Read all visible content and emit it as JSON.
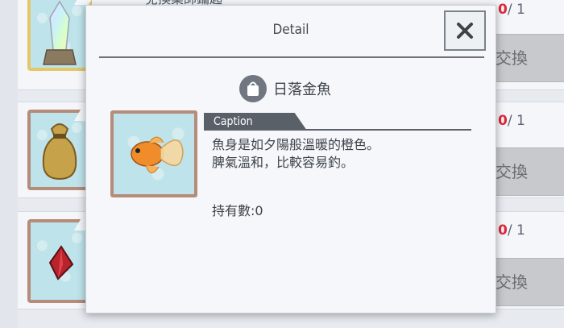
{
  "shop_list": {
    "rows": [
      {
        "truncated_text": "兌換藥師鑰匙",
        "count_owned": "0",
        "count_total": "/ 1",
        "exchange_label": "交換"
      },
      {
        "count_owned": "0",
        "count_total": "/ 1",
        "exchange_label": "交換"
      },
      {
        "count_owned": "0",
        "count_total": "/ 1",
        "exchange_label": "交換"
      }
    ]
  },
  "dialog": {
    "title": "Detail",
    "item_name": "日落金魚",
    "caption_label": "Caption",
    "description_line1": "魚身是如夕陽般溫暖的橙色。",
    "description_line2": "脾氣溫和，比較容易釣。",
    "owned_text": "持有數:0",
    "icons": {
      "close": "close-icon",
      "bag": "bag-icon",
      "item": "goldfish-icon"
    }
  }
}
